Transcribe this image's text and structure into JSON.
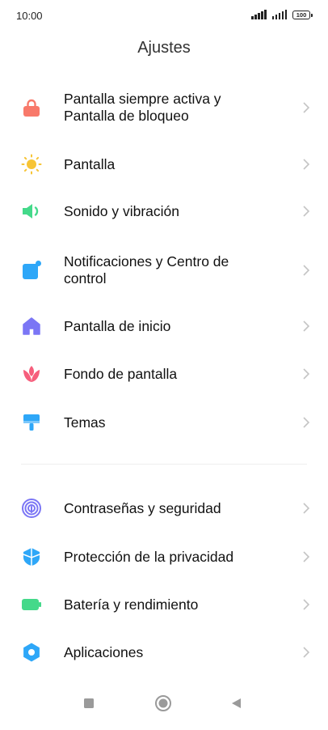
{
  "status_bar": {
    "time": "10:00",
    "battery": "100"
  },
  "header": {
    "title": "Ajustes"
  },
  "settings": [
    {
      "label_line1": "Pantalla siempre activa y",
      "label_line2": "Pantalla de bloqueo",
      "icon": "lock-icon",
      "color": "#f8796a"
    },
    {
      "label": "Pantalla",
      "icon": "sun-icon",
      "color": "#f7c435"
    },
    {
      "label": "Sonido y vibración",
      "icon": "speaker-icon",
      "color": "#44d98a"
    },
    {
      "label_line1": "Notificaciones y Centro de",
      "label_line2": "control",
      "icon": "notification-icon",
      "color": "#2ea7f8"
    },
    {
      "label": "Pantalla de inicio",
      "icon": "home-icon",
      "color": "#7b76f5"
    },
    {
      "label": "Fondo de pantalla",
      "icon": "flower-icon",
      "color": "#f65e7c"
    },
    {
      "label": "Temas",
      "icon": "paintbrush-icon",
      "color": "#2ea7f8"
    },
    {
      "label": "Contraseñas y seguridad",
      "icon": "fingerprint-icon",
      "color": "#7b76f5"
    },
    {
      "label": "Protección de la privacidad",
      "icon": "shield-icon",
      "color": "#2ea7f8"
    },
    {
      "label": "Batería y rendimiento",
      "icon": "battery-icon",
      "color": "#44d98a"
    },
    {
      "label": "Aplicaciones",
      "icon": "gear-icon",
      "color": "#2ea7f8"
    }
  ],
  "nav": {
    "recents": "recents-icon",
    "home": "home-button-icon",
    "back": "back-icon"
  }
}
